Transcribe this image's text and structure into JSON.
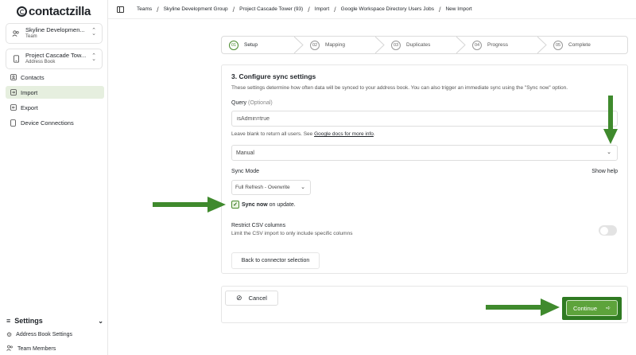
{
  "brand": {
    "name": "contactzilla"
  },
  "sidebar": {
    "team_switcher": {
      "name": "Skyline Developmen...",
      "type": "Team"
    },
    "book_switcher": {
      "name": "Project Cascade Tow...",
      "type": "Address Book"
    },
    "nav": [
      {
        "label": "Contacts",
        "icon": "contacts-icon"
      },
      {
        "label": "Import",
        "icon": "import-icon",
        "active": true
      },
      {
        "label": "Export",
        "icon": "export-icon"
      },
      {
        "label": "Device Connections",
        "icon": "device-icon"
      }
    ],
    "settings": {
      "label": "Settings",
      "items": [
        {
          "label": "Address Book Settings",
          "icon": "gear-icon"
        },
        {
          "label": "Team Members",
          "icon": "users-icon"
        }
      ]
    }
  },
  "breadcrumb": [
    "Teams",
    "Skyline Development Group",
    "Project Cascade Tower (93)",
    "Import",
    "Google Workspace Directory Users Jobs",
    "New Import"
  ],
  "stepper": [
    {
      "num": "01",
      "label": "Setup",
      "active": true
    },
    {
      "num": "02",
      "label": "Mapping"
    },
    {
      "num": "03",
      "label": "Duplicates"
    },
    {
      "num": "04",
      "label": "Progress"
    },
    {
      "num": "05",
      "label": "Complete"
    }
  ],
  "form": {
    "title": "3. Configure sync settings",
    "description": "These settings determine how often data will be synced to your address book. You can also trigger an immediate sync using the \"Sync now\" option.",
    "query_label": "Query",
    "query_optional": "(Optional)",
    "query_value": "isAdmin=true",
    "query_help": "Leave blank to return all users. See",
    "query_help_link": "Google docs for more info",
    "query_help_end": ".",
    "frequency_value": "Manual",
    "sync_mode_label": "Sync Mode",
    "show_help": "Show help",
    "sync_mode_value": "Full Refresh - Overwrite",
    "sync_now_bold": "Sync now",
    "sync_now_rest": "on update.",
    "sync_now_checked": true,
    "restrict_title": "Restrict CSV columns",
    "restrict_desc": "Limit the CSV import to only include specific columns",
    "restrict_enabled": false,
    "back_button": "Back to connector selection"
  },
  "footer": {
    "cancel": "Cancel",
    "continue": "Continue"
  },
  "colors": {
    "accent": "#5da33b",
    "annotation_arrow": "#3f8a2d"
  }
}
